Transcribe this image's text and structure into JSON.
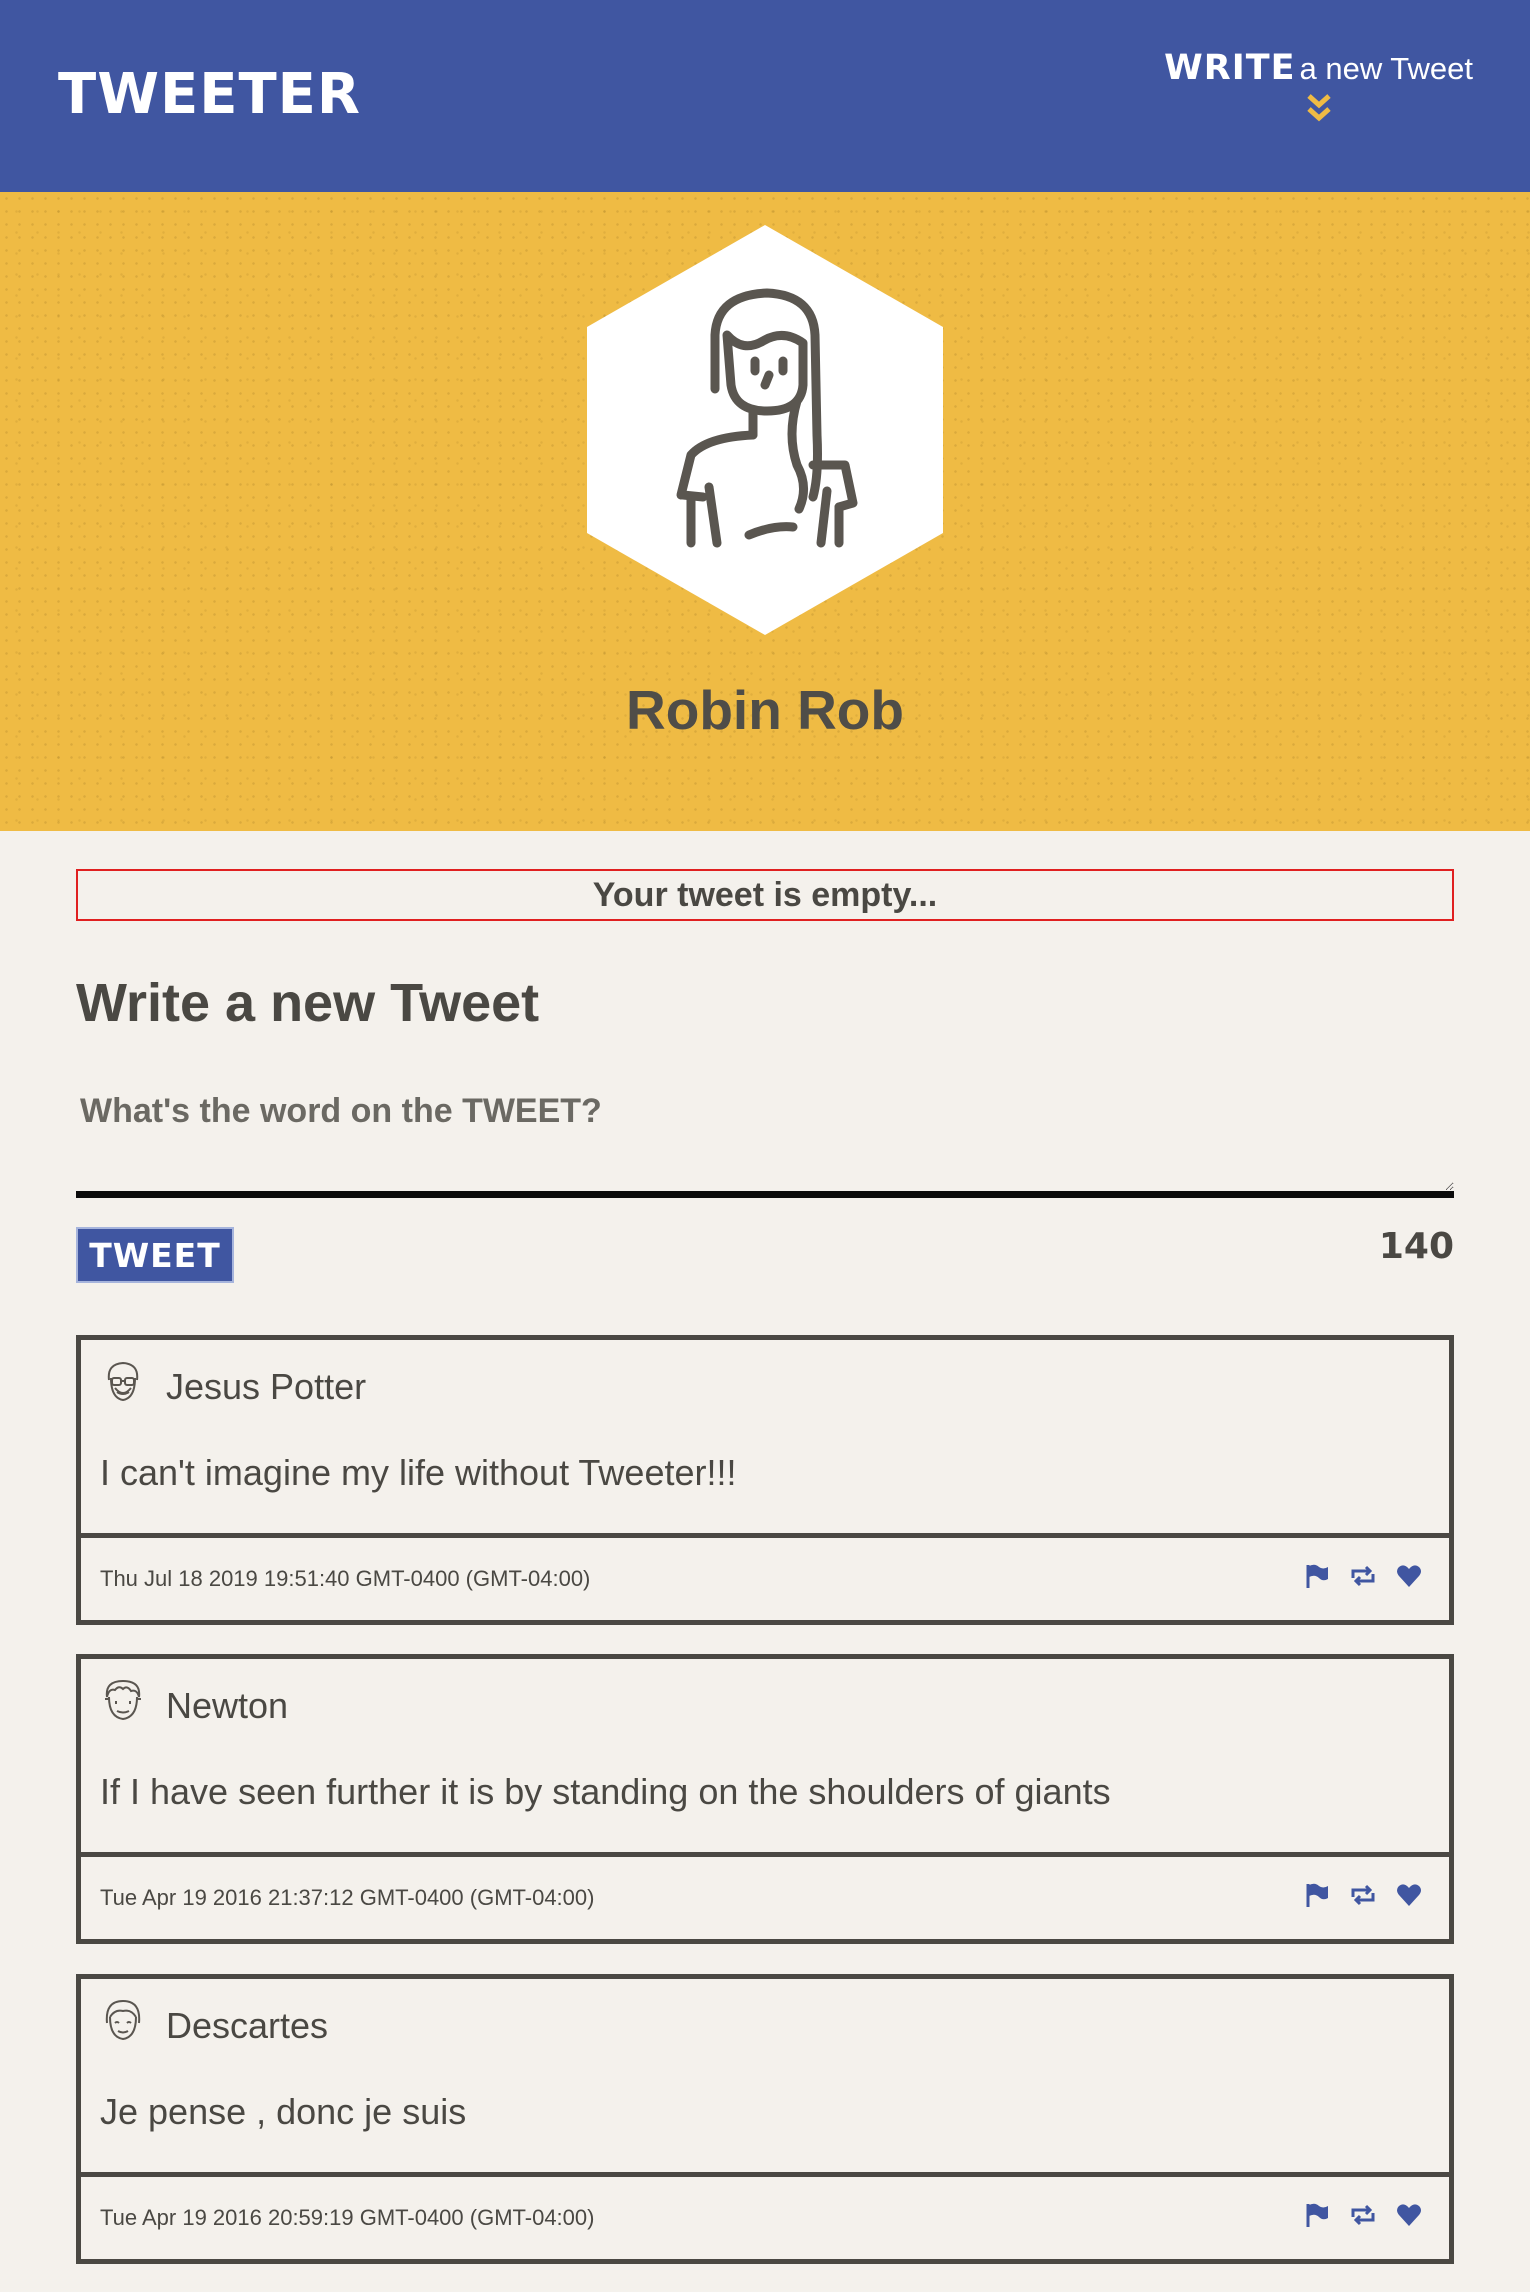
{
  "header": {
    "brand": "TWEETER",
    "compose_toggle": {
      "bold_label": "WRITE",
      "label": "a new Tweet",
      "icon": "double-chevron-down-icon"
    }
  },
  "profile": {
    "avatar_icon": "woman-avatar-icon",
    "name": "Robin Rob"
  },
  "compose": {
    "error": "Your tweet is empty...",
    "title": "Write a new Tweet",
    "placeholder": "What's the word on the TWEET?",
    "value": "",
    "button_label": "TWEET",
    "char_count": "140"
  },
  "tweets": [
    {
      "avatar_icon": "man-glasses-avatar-icon",
      "author": "Jesus Potter",
      "text": "I can't imagine my life without Tweeter!!!",
      "timestamp": "Thu Jul 18 2019 19:51:40 GMT-0400 (GMT-04:00)"
    },
    {
      "avatar_icon": "man-curly-avatar-icon",
      "author": "Newton",
      "text": "If I have seen further it is by standing on the shoulders of giants",
      "timestamp": "Tue Apr 19 2016 21:37:12 GMT-0400 (GMT-04:00)"
    },
    {
      "avatar_icon": "man-bangs-avatar-icon",
      "author": "Descartes",
      "text": "Je pense , donc je suis",
      "timestamp": "Tue Apr 19 2016 20:59:19 GMT-0400 (GMT-04:00)"
    }
  ],
  "tweet_actions": [
    "flag-icon",
    "retweet-icon",
    "heart-icon"
  ],
  "colors": {
    "header_bg": "#4056a1",
    "profile_bg": "#efbb44",
    "page_bg": "#f4f1ec",
    "text": "#4a4843",
    "accent_chevron": "#efbb44",
    "error_border": "#e02020"
  }
}
